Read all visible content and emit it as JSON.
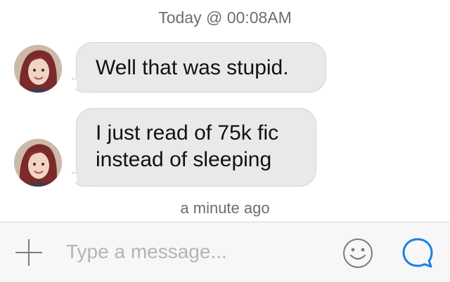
{
  "conversation": {
    "timestamp": "Today @ 00:08AM",
    "messages": [
      {
        "lines": [
          "Well that was stupid."
        ]
      },
      {
        "lines": [
          "I just read of 75k fic",
          "instead of sleeping"
        ]
      }
    ],
    "status": "a minute ago"
  },
  "composer": {
    "placeholder": "Type a message...",
    "add_icon": "plus-icon",
    "emoji_icon": "smiley-icon",
    "send_icon": "chat-bubble-icon"
  },
  "colors": {
    "bubble_bg": "#e9e9ec",
    "accent": "#1a7fe6",
    "muted_text": "#6d6d72",
    "composer_bg": "#f7f7f7"
  }
}
